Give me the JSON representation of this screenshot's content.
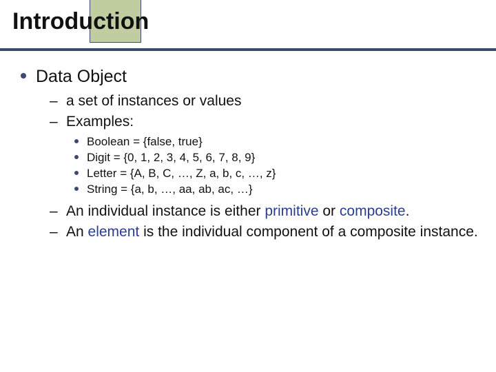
{
  "title": "Introduction",
  "level1": [
    "Data Object"
  ],
  "level2a": [
    "a set of instances or values",
    "Examples:"
  ],
  "level3": [
    "Boolean = {false, true}",
    "Digit = {0, 1, 2, 3, 4, 5, 6, 7, 8, 9}",
    "Letter = {A, B, C, …, Z, a, b, c, …, z}",
    "String = {a, b, …, aa, ab, ac, …}"
  ],
  "level2b": [
    {
      "pre": "An individual instance is either ",
      "kw1": "primitive",
      "mid": " or ",
      "kw2": "composite",
      "post": "."
    },
    {
      "pre": "An ",
      "kw": "element",
      "post": " is the individual component of a composite instance."
    }
  ]
}
